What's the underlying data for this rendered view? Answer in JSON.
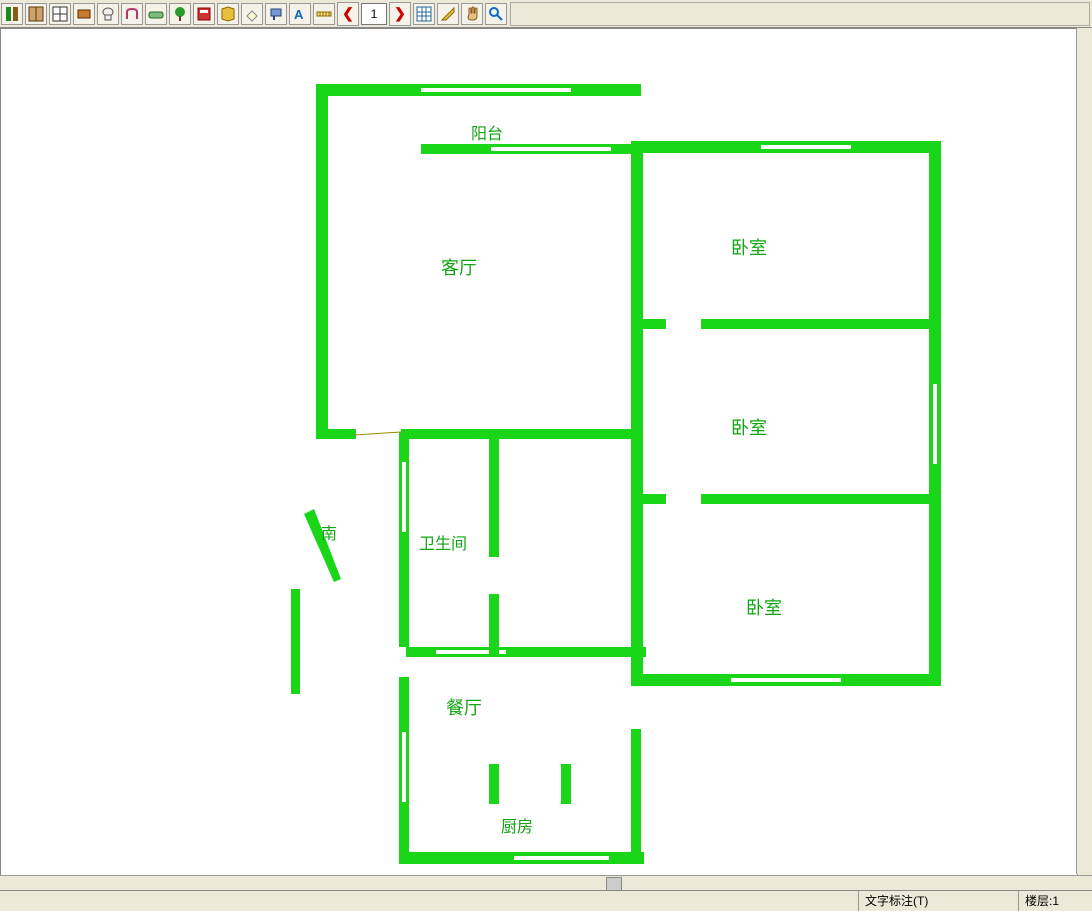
{
  "toolbar": {
    "icons": [
      "door-icon",
      "door2-icon",
      "window-icon",
      "furniture-icon",
      "toilet-icon",
      "chair-icon",
      "sofa-icon",
      "tree-icon",
      "cabinet-icon",
      "book-icon",
      "eraser-icon",
      "paint-icon",
      "text-icon",
      "ruler-icon"
    ],
    "page_value": "1",
    "nav_icons": [
      "grid-icon",
      "measure-icon",
      "hand-icon",
      "zoom-icon"
    ]
  },
  "rooms": {
    "balcony": "阳台",
    "living": "客厅",
    "bed1": "卧室",
    "bed2": "卧室",
    "bed3": "卧室",
    "bath": "卫生间",
    "dining": "餐厅",
    "kitchen": "厨房",
    "compass": "南"
  },
  "status": {
    "mode": "文字标注(T)",
    "floor": "楼层:1"
  },
  "colors": {
    "wall": "#19d619",
    "label": "#11a511"
  }
}
